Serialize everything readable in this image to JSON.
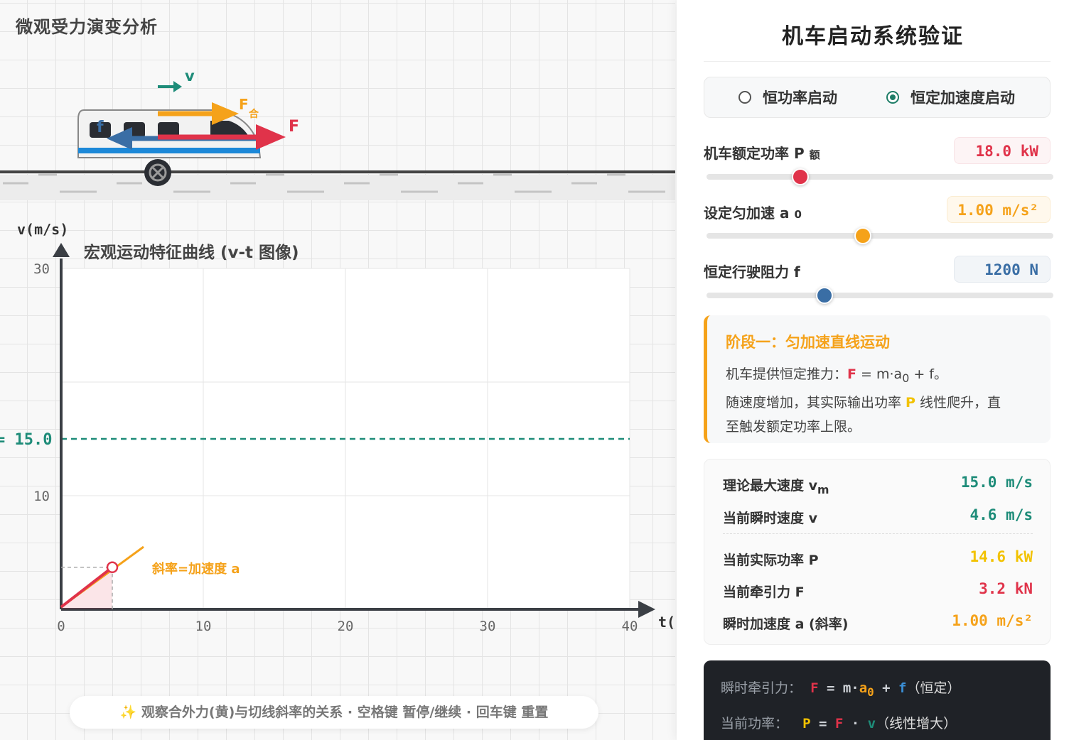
{
  "stage": {
    "title": "微观受力演变分析",
    "hint": "✨ 观察合外力(黄)与切线斜率的关系 · 空格键 暂停/继续 · 回车键 重置",
    "force_labels": {
      "v": "v",
      "f_net": "F",
      "f_net_sub": "合",
      "f_traction": "F",
      "f_drag": "f"
    },
    "colors": {
      "velocity": "#1e8c79",
      "net_force": "#f5a21a",
      "traction": "#e0334a",
      "drag": "#3a6ea5"
    }
  },
  "chart_data": {
    "type": "line",
    "title": "宏观运动特征曲线 (v-t 图像)",
    "xlabel": "t(",
    "ylabel": "v(m/s)",
    "xlim": [
      0,
      40
    ],
    "ylim": [
      0,
      30
    ],
    "x_ticks": [
      0,
      10,
      20,
      30,
      40
    ],
    "y_ticks": [
      10,
      30
    ],
    "vmax_line": {
      "value": 15.0,
      "label": "= 15.0"
    },
    "series": [
      {
        "x": [
          0,
          5.8
        ],
        "y": [
          0.2,
          5.5
        ]
      }
    ],
    "current_point": {
      "t": 3.6,
      "v": 3.7
    },
    "slope_label": "斜率=加速度 a",
    "grid": true
  },
  "panel": {
    "title": "机车启动系统验证",
    "modes": [
      {
        "label": "恒功率启动",
        "selected": false
      },
      {
        "label": "恒定加速度启动",
        "selected": true
      }
    ],
    "params": {
      "power": {
        "label": "机车额定功率 P",
        "sub": "额",
        "value": "18.0 kW",
        "fraction": 0.27,
        "color": "#e0334a"
      },
      "accel": {
        "label": "设定匀加速 a",
        "sub": "0",
        "value": "1.00 m/s²",
        "fraction": 0.45,
        "color": "#f5a21a"
      },
      "drag": {
        "label": "恒定行驶阻力 f",
        "sub": "",
        "value": "1200 N",
        "fraction": 0.34,
        "color": "#3a6ea5"
      }
    },
    "phase": {
      "title": "阶段一：匀加速直线运动",
      "line1_pre": "机车提供恒定推力：",
      "line1_F": "F",
      "line1_eq": " = m·a",
      "line1_sub": "0",
      "line1_post": " + f。",
      "line2_pre": "随速度增加，其实际输出功率 ",
      "line2_P": "P",
      "line2_post": " 线性爬升，直",
      "line3": "至触发额定功率上限。"
    },
    "stats": [
      {
        "label": "理论最大速度 v",
        "sub": "m",
        "value": "15.0 m/s",
        "color": "#1e8c79"
      },
      {
        "label": "当前瞬时速度 v",
        "sub": "",
        "value": "4.6 m/s",
        "color": "#1e8c79"
      },
      {
        "label": "当前实际功率 P",
        "sub": "",
        "value": "14.6 kW",
        "color": "#f2c200"
      },
      {
        "label": "当前牵引力 F",
        "sub": "",
        "value": "3.2 kN",
        "color": "#e0334a"
      },
      {
        "label": "瞬时加速度 a (斜率)",
        "sub": "",
        "value": "1.00 m/s²",
        "color": "#f5a21a"
      }
    ],
    "formulas": {
      "row1_label": "瞬时牵引力：",
      "row1_F": "F",
      "row1_eq": " = m·",
      "row1_a": "a",
      "row1_a_sub": "0",
      "row1_plus": " + ",
      "row1_f": "f",
      "row1_note": "（恒定）",
      "row2_label": "当前功率：",
      "row2_P": "P",
      "row2_eq": " = ",
      "row2_F": "F",
      "row2_dot": " · ",
      "row2_v": "v",
      "row2_note": "（线性增大）"
    }
  }
}
